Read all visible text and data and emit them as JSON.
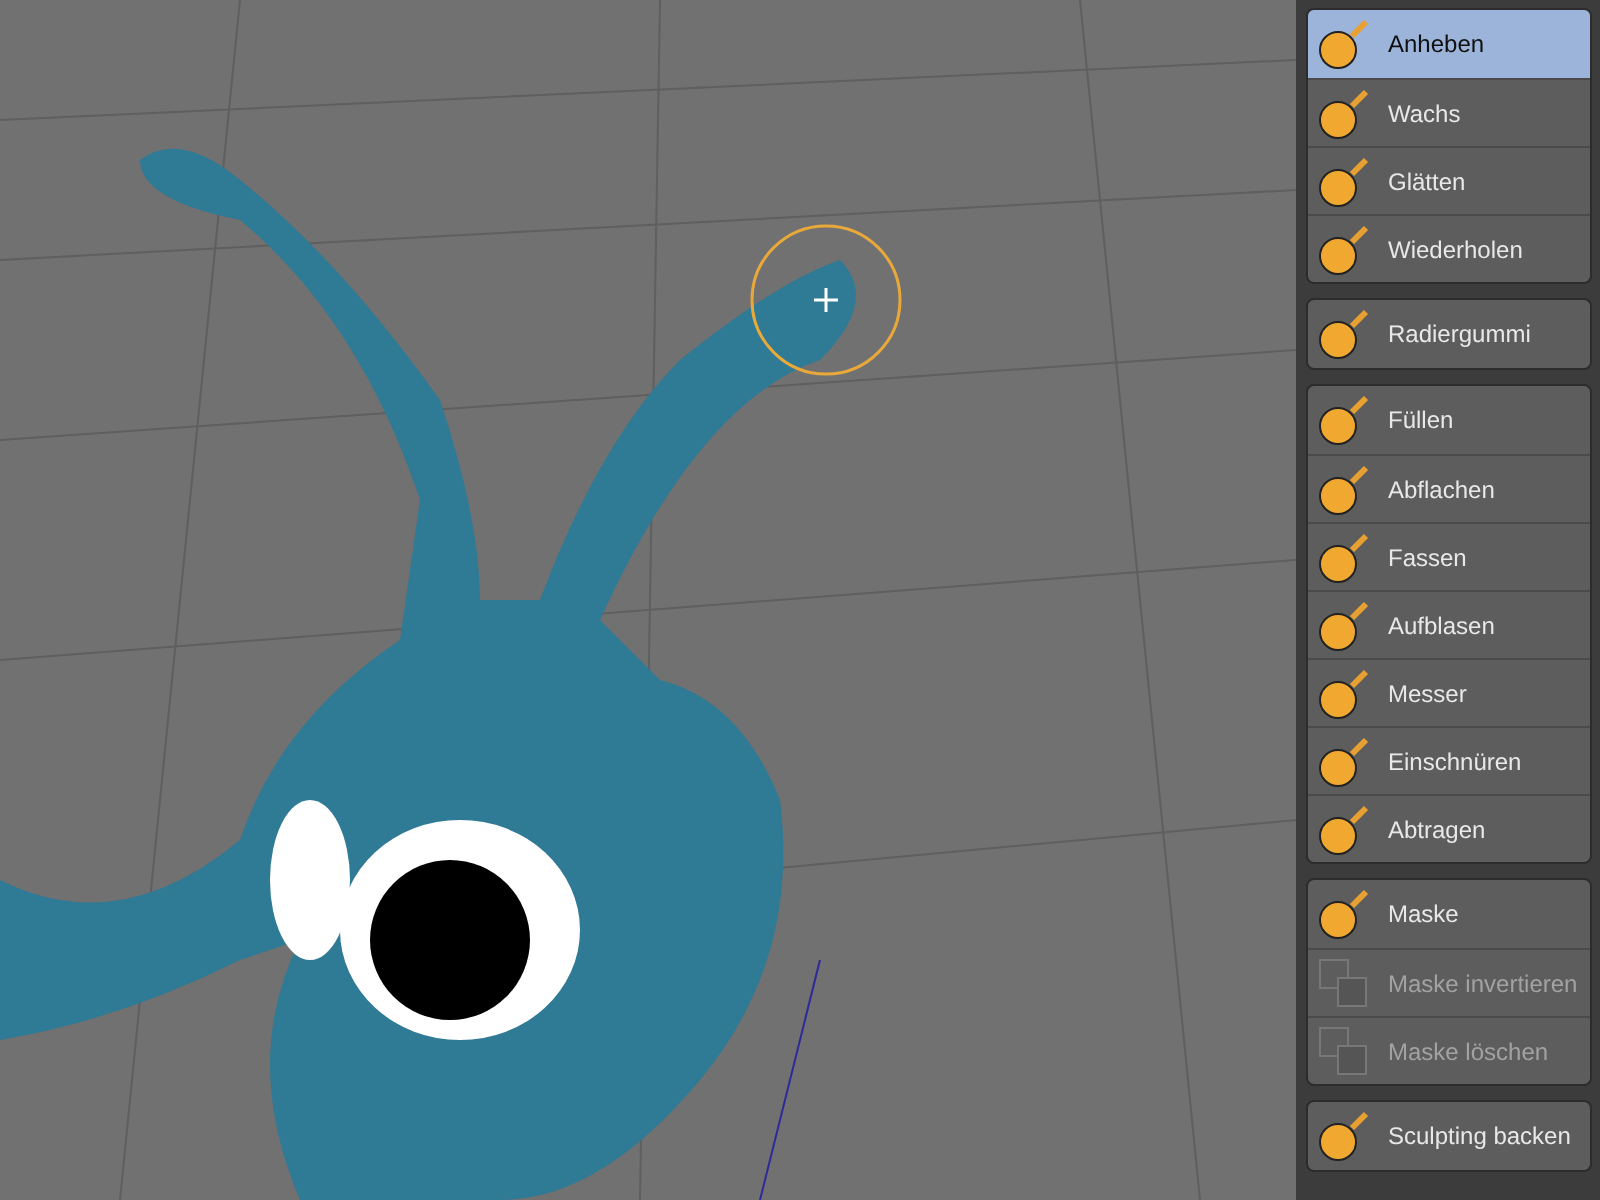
{
  "tool_groups": [
    {
      "tools": [
        {
          "label": "Anheben",
          "selected": true,
          "disabled": false
        },
        {
          "label": "Wachs",
          "selected": false,
          "disabled": false
        },
        {
          "label": "Glätten",
          "selected": false,
          "disabled": false
        },
        {
          "label": "Wiederholen",
          "selected": false,
          "disabled": false
        }
      ]
    },
    {
      "tools": [
        {
          "label": "Radiergummi",
          "selected": false,
          "disabled": false
        }
      ]
    },
    {
      "tools": [
        {
          "label": "Füllen",
          "selected": false,
          "disabled": false
        },
        {
          "label": "Abflachen",
          "selected": false,
          "disabled": false
        },
        {
          "label": "Fassen",
          "selected": false,
          "disabled": false
        },
        {
          "label": "Aufblasen",
          "selected": false,
          "disabled": false
        },
        {
          "label": "Messer",
          "selected": false,
          "disabled": false
        },
        {
          "label": "Einschnüren",
          "selected": false,
          "disabled": false
        },
        {
          "label": "Abtragen",
          "selected": false,
          "disabled": false
        }
      ]
    },
    {
      "tools": [
        {
          "label": "Maske",
          "selected": false,
          "disabled": false
        },
        {
          "label": "Maske invertieren",
          "selected": false,
          "disabled": true
        },
        {
          "label": "Maske löschen",
          "selected": false,
          "disabled": true
        }
      ]
    },
    {
      "tools": [
        {
          "label": "Sculpting backen",
          "selected": false,
          "disabled": false
        }
      ]
    }
  ]
}
